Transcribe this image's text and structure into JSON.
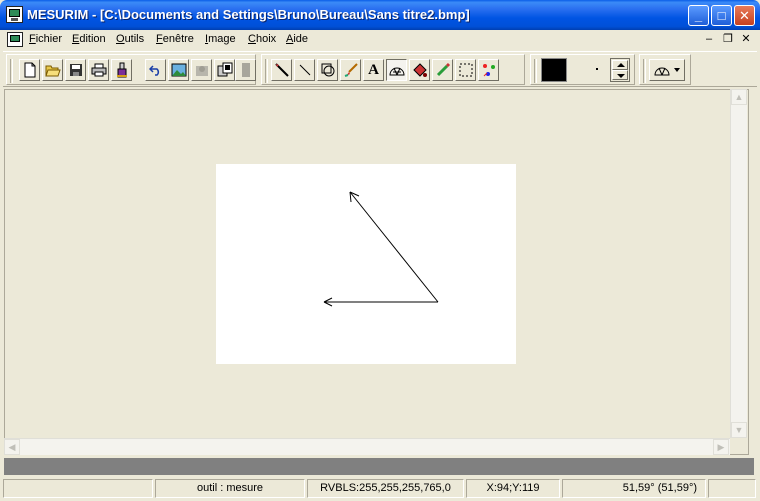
{
  "window": {
    "title": "MESURIM - [C:\\Documents and Settings\\Bruno\\Bureau\\Sans titre2.bmp]",
    "app_icon": "mesurim-app-icon",
    "controls": {
      "minimize": "_",
      "maximize": "□",
      "close": "✕"
    }
  },
  "menu": {
    "items": [
      {
        "label": "Fichier"
      },
      {
        "label": "Edition"
      },
      {
        "label": "Outils"
      },
      {
        "label": "Fenêtre"
      },
      {
        "label": "Image"
      },
      {
        "label": "Choix"
      },
      {
        "label": "Aide"
      }
    ],
    "mdi_controls": {
      "minimize": "–",
      "restore": "❐",
      "close": "✕"
    }
  },
  "toolbar": {
    "file_tools": [
      "new-document-icon",
      "open-folder-icon",
      "save-disk-icon",
      "print-icon",
      "lab-flask-icon"
    ],
    "edit_tools": [
      "undo-icon",
      "image-icon",
      "paste-disabled-icon",
      "copy-image-icon",
      "disabled-icon"
    ],
    "draw_tools": [
      "pencil-icon",
      "line-icon",
      "polygon-icon",
      "brush-icon",
      "text-icon",
      "protractor-icon",
      "bucket-icon",
      "eyedropper-icon",
      "selection-rect-icon",
      "color-points-icon"
    ],
    "text_tool_label": "A",
    "active_tool": "protractor-icon",
    "current_color": "#000000"
  },
  "statusbar": {
    "tool": "outil : mesure",
    "color_values": "RVBLS:255,255,255,765,0",
    "coordinates": "X:94;Y:119",
    "angle": "51,59° (51,59°)"
  }
}
